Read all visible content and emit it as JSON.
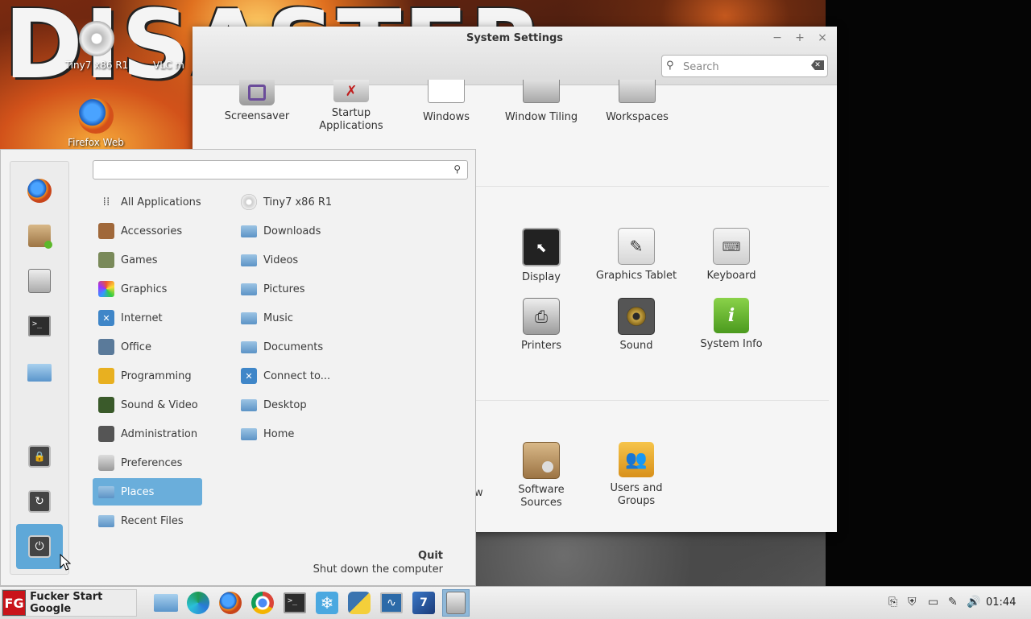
{
  "desktop": {
    "wallpaper_title": "DISASTER",
    "icons": [
      {
        "label": "Tiny7 x86 R1"
      },
      {
        "label": "VLC m"
      },
      {
        "label": "Firefox Web"
      }
    ]
  },
  "settings": {
    "title": "System Settings",
    "controls": {
      "minimize": "−",
      "maximize": "+",
      "close": "×"
    },
    "search_placeholder": "Search",
    "items": [
      {
        "label": "Screensaver",
        "icon": "screensaver-icon"
      },
      {
        "label": "Startup\nApplications",
        "icon": "startup-applications-icon"
      },
      {
        "label": "Windows",
        "icon": "windows-icon"
      },
      {
        "label": "Window Tiling",
        "icon": "window-tiling-icon"
      },
      {
        "label": "Workspaces",
        "icon": "workspaces-icon"
      },
      {
        "label": "Display",
        "icon": "display-icon"
      },
      {
        "label": "Graphics Tablet",
        "icon": "graphics-tablet-icon"
      },
      {
        "label": "Keyboard",
        "icon": "keyboard-icon"
      },
      {
        "label": "Printers",
        "icon": "printer-icon"
      },
      {
        "label": "Sound",
        "icon": "speaker-icon"
      },
      {
        "label": "System Info",
        "icon": "info-icon"
      },
      {
        "label": "Software\nSources",
        "icon": "software-sources-icon"
      },
      {
        "label": "Users and\nGroups",
        "icon": "users-icon"
      }
    ],
    "partial_labels": [
      "t",
      "w"
    ]
  },
  "menu": {
    "search_value": "",
    "categories": [
      "All Applications",
      "Accessories",
      "Games",
      "Graphics",
      "Internet",
      "Office",
      "Programming",
      "Sound & Video",
      "Administration",
      "Preferences",
      "Places",
      "Recent Files"
    ],
    "selected_category": "Places",
    "places": [
      "Tiny7 x86 R1",
      "Downloads",
      "Videos",
      "Pictures",
      "Music",
      "Documents",
      "Connect to...",
      "Desktop",
      "Home"
    ],
    "quit_title": "Quit",
    "quit_desc": "Shut down the computer",
    "favorites": [
      "firefox-icon",
      "package-installer-icon",
      "settings-sliders-icon",
      "terminal-icon",
      "folder-icon",
      "lock-screen-icon",
      "logout-icon",
      "power-icon"
    ]
  },
  "taskbar": {
    "start_logo": "FG",
    "start_label": "Fucker Start Google",
    "apps": [
      "files-icon",
      "edge-dev-icon",
      "firefox-icon",
      "chrome-icon",
      "terminal-icon",
      "snowflake-icon",
      "python-icon",
      "system-monitor-icon",
      "tiny7-icon",
      "settings-icon"
    ],
    "clock": "01:44"
  },
  "colors": {
    "menu_highlight": "#6aaedb",
    "fav_highlight": "#5fa8d8",
    "start_red": "#c9141a"
  }
}
